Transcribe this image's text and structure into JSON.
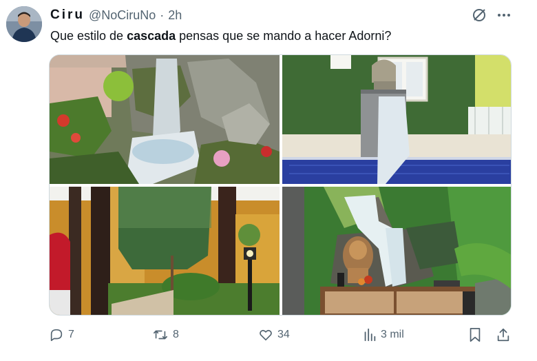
{
  "author": {
    "display_name": "Ciru",
    "handle": "@NoCiruNo",
    "separator": "·",
    "time": "2h"
  },
  "tweet": {
    "text_before": "Que estilo de ",
    "text_bold": "cascada",
    "text_after": " pensas que se mando a hacer Adorni?"
  },
  "media": [
    {
      "subject": "rock garden waterfall"
    },
    {
      "subject": "stone pillar fountain over pool"
    },
    {
      "subject": "garden chain curtain waterfall"
    },
    {
      "subject": "waterfall mural with lion"
    }
  ],
  "actions": {
    "replies": "7",
    "reposts": "8",
    "likes": "34",
    "views": "3 mil"
  },
  "colors": {
    "text": "#0f1419",
    "secondary": "#536471",
    "border": "#cfd9de"
  },
  "icons": [
    "avatar",
    "grok-icon",
    "more-icon",
    "reply-icon",
    "repost-icon",
    "like-icon",
    "views-icon",
    "bookmark-icon",
    "share-icon"
  ]
}
